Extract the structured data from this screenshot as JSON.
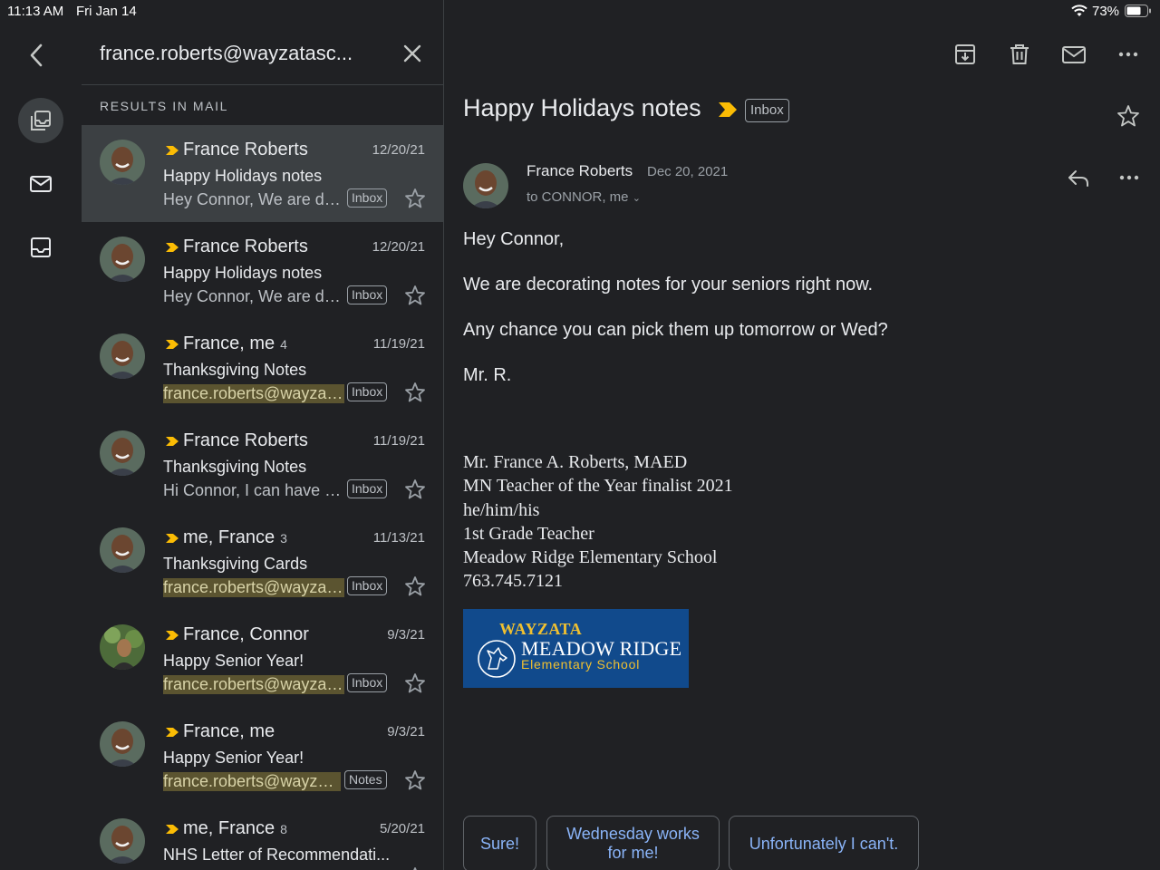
{
  "status_bar": {
    "time": "11:13 AM",
    "date": "Fri Jan 14",
    "battery": "73%"
  },
  "search": {
    "query": "france.roberts@wayzatasc...",
    "results_label": "RESULTS IN MAIL"
  },
  "list": [
    {
      "sender": "France Roberts",
      "count": "",
      "date": "12/20/21",
      "subject": "Happy Holidays notes",
      "snippet": "Hey Connor, We are decorating notes for your seniors",
      "label": "Inbox",
      "highlight": false,
      "selected": true,
      "avatar": "man"
    },
    {
      "sender": "France Roberts",
      "count": "",
      "date": "12/20/21",
      "subject": "Happy Holidays notes",
      "snippet": "Hey Connor, We are decorating notes for your seniors",
      "label": "Inbox",
      "highlight": false,
      "selected": false,
      "avatar": "man"
    },
    {
      "sender": "France, me",
      "count": "4",
      "date": "11/19/21",
      "subject": "Thanksgiving Notes",
      "snippet": "france.roberts@wayzatasc",
      "label": "Inbox",
      "highlight": true,
      "selected": false,
      "avatar": "man"
    },
    {
      "sender": "France Roberts",
      "count": "",
      "date": "11/19/21",
      "subject": "Thanksgiving Notes",
      "snippet": "Hi Connor, I can have them",
      "label": "Inbox",
      "highlight": false,
      "selected": false,
      "avatar": "man"
    },
    {
      "sender": "me, France",
      "count": "3",
      "date": "11/13/21",
      "subject": "Thanksgiving Cards",
      "snippet": "france.roberts@wayzatasc",
      "label": "Inbox",
      "highlight": true,
      "selected": false,
      "avatar": "man"
    },
    {
      "sender": "France, Connor",
      "count": "",
      "date": "9/3/21",
      "subject": "Happy Senior Year!",
      "snippet": "france.roberts@wayzatasc",
      "label": "Inbox",
      "highlight": true,
      "selected": false,
      "avatar": "photo"
    },
    {
      "sender": "France, me",
      "count": "",
      "date": "9/3/21",
      "subject": "Happy Senior Year!",
      "snippet": "france.roberts@wayzatasc",
      "label": "Notes",
      "highlight": true,
      "selected": false,
      "avatar": "man"
    },
    {
      "sender": "me, France",
      "count": "8",
      "date": "5/20/21",
      "subject": "NHS Letter of Recommendati...",
      "snippet": "",
      "label": "",
      "highlight": false,
      "selected": false,
      "avatar": "man"
    }
  ],
  "message": {
    "subject": "Happy Holidays notes",
    "label": "Inbox",
    "sender": "France Roberts",
    "date": "Dec 20, 2021",
    "to": "to CONNOR, me",
    "body": [
      "Hey Connor,",
      "We are decorating notes for your seniors right now.",
      "Any chance you can pick them up tomorrow or Wed?",
      "Mr. R."
    ],
    "signature": [
      "Mr. France A. Roberts, MAED",
      "MN Teacher of the Year finalist 2021",
      "he/him/his",
      "1st Grade Teacher",
      "Meadow Ridge Elementary School",
      "763.745.7121"
    ],
    "logo": {
      "line1": "WAYZATA",
      "line2": "MEADOW RIDGE",
      "line3": "Elementary School"
    }
  },
  "smart_replies": [
    "Sure!",
    "Wednesday works for me!",
    "Unfortunately I can't."
  ],
  "colors": {
    "background": "#202124",
    "selected_row": "#3c4043",
    "important": "#fbbc04",
    "link": "#8ab4f8"
  }
}
